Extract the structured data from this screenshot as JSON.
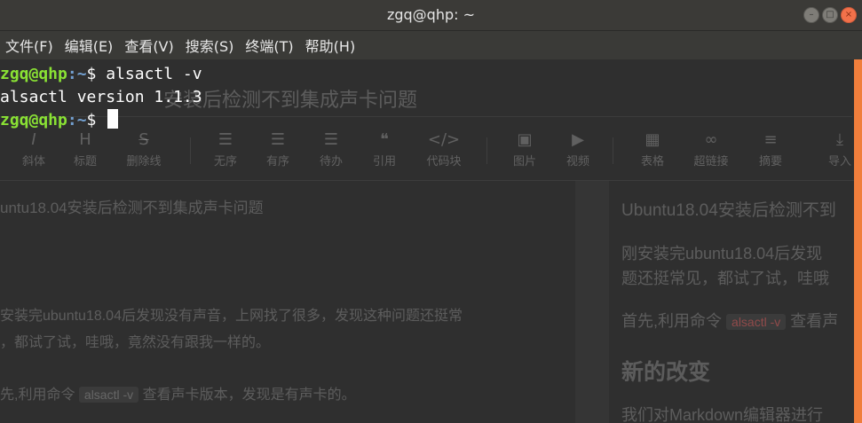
{
  "window": {
    "title": "zgq@qhp: ~",
    "buttons": {
      "minimize": "–",
      "maximize": "□",
      "close": "×"
    }
  },
  "menubar": [
    {
      "label": "文件(F)"
    },
    {
      "label": "编辑(E)"
    },
    {
      "label": "查看(V)"
    },
    {
      "label": "搜索(S)"
    },
    {
      "label": "终端(T)"
    },
    {
      "label": "帮助(H)"
    }
  ],
  "terminal": {
    "prompt_user_host": "zgq@qhp",
    "prompt_path": ":~",
    "prompt_symbol": "$ ",
    "lines": [
      {
        "command": "alsactl -v"
      },
      {
        "output": "alsactl version 1.1.3"
      },
      {
        "command": ""
      }
    ]
  },
  "background_editor": {
    "title": "安装后检测不到集成声卡问题",
    "toolbar": [
      {
        "icon": "italic-icon",
        "glyph": "I",
        "label": "斜体"
      },
      {
        "icon": "heading-icon",
        "glyph": "H",
        "label": "标题"
      },
      {
        "icon": "strikethrough-icon",
        "glyph": "S",
        "label": "删除线"
      },
      {
        "icon": "unordered-list-icon",
        "glyph": "☰",
        "label": "无序"
      },
      {
        "icon": "ordered-list-icon",
        "glyph": "☰",
        "label": "有序"
      },
      {
        "icon": "todo-icon",
        "glyph": "☰",
        "label": "待办"
      },
      {
        "icon": "quote-icon",
        "glyph": "❝",
        "label": "引用"
      },
      {
        "icon": "code-block-icon",
        "glyph": "</>",
        "label": "代码块"
      },
      {
        "icon": "image-icon",
        "glyph": "▣",
        "label": "图片"
      },
      {
        "icon": "video-icon",
        "glyph": "▶",
        "label": "视频"
      },
      {
        "icon": "table-icon",
        "glyph": "▦",
        "label": "表格"
      },
      {
        "icon": "link-icon",
        "glyph": "∞",
        "label": "超链接"
      },
      {
        "icon": "summary-icon",
        "glyph": "≡",
        "label": "摘要"
      },
      {
        "icon": "import-icon",
        "glyph": "⤓",
        "label": "导入"
      }
    ],
    "left": {
      "heading": "untu18.04安装后检测不到集成声卡问题",
      "para1_line1": "安装完ubuntu18.04后发现没有声音，上网找了很多，发现这种问题还挺常",
      "para1_line2": "，都试了试，哇哦，竟然没有跟我一样的。",
      "para2_prefix": "先,利用命令",
      "para2_code": "alsactl -v",
      "para2_suffix": "查看声卡版本，发现是有声卡的。"
    },
    "right": {
      "heading": "Ubuntu18.04安装后检测不到",
      "para1_line1": "刚安装完ubuntu18.04后发现",
      "para1_line2": "题还挺常见，都试了试，哇哦",
      "para2_prefix": "首先,利用命令",
      "para2_code": "alsactl -v",
      "para2_suffix": "查看声",
      "section_heading": "新的改变",
      "para3": "我们对Markdown编辑器进行"
    }
  },
  "colors": {
    "terminal_bg": "#2f2f2f",
    "titlebar_bg": "#3b3a37",
    "prompt_user": "#8ae234",
    "prompt_path": "#729fcf",
    "scrollbar": "#f07e3c",
    "close_button": "#f2714a"
  }
}
